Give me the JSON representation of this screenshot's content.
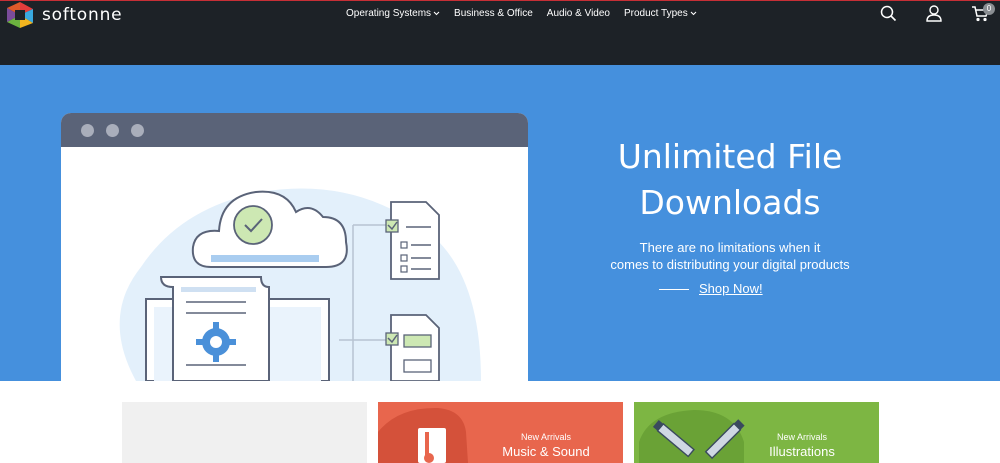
{
  "header": {
    "brand": "softonne",
    "nav": [
      {
        "label": "Operating Systems",
        "has_dropdown": true
      },
      {
        "label": "Business & Office",
        "has_dropdown": false
      },
      {
        "label": "Audio & Video",
        "has_dropdown": false
      },
      {
        "label": "Product Types",
        "has_dropdown": true
      }
    ],
    "icons": [
      "search-icon",
      "user-icon",
      "cart-icon"
    ],
    "cart_count": "0"
  },
  "hero": {
    "title_line1": "Unlimited File",
    "title_line2": "Downloads",
    "subtitle_line1": "There are no limitations when it",
    "subtitle_line2": "comes to distributing your digital products",
    "cta_label": "Shop Now!"
  },
  "cards": [
    {
      "kicker": "",
      "title": ""
    },
    {
      "kicker": "New Arrivals",
      "title": "Music & Sound",
      "icon": "music-note-icon"
    },
    {
      "kicker": "New Arrivals",
      "title": "Illustrations",
      "icon": "pencils-icon"
    }
  ],
  "colors": {
    "header_bg": "#1d2227",
    "header_accent": "#c62f36",
    "hero_bg": "#4590dd",
    "music_card": "#e8664d",
    "illustrations_card": "#7db643"
  }
}
